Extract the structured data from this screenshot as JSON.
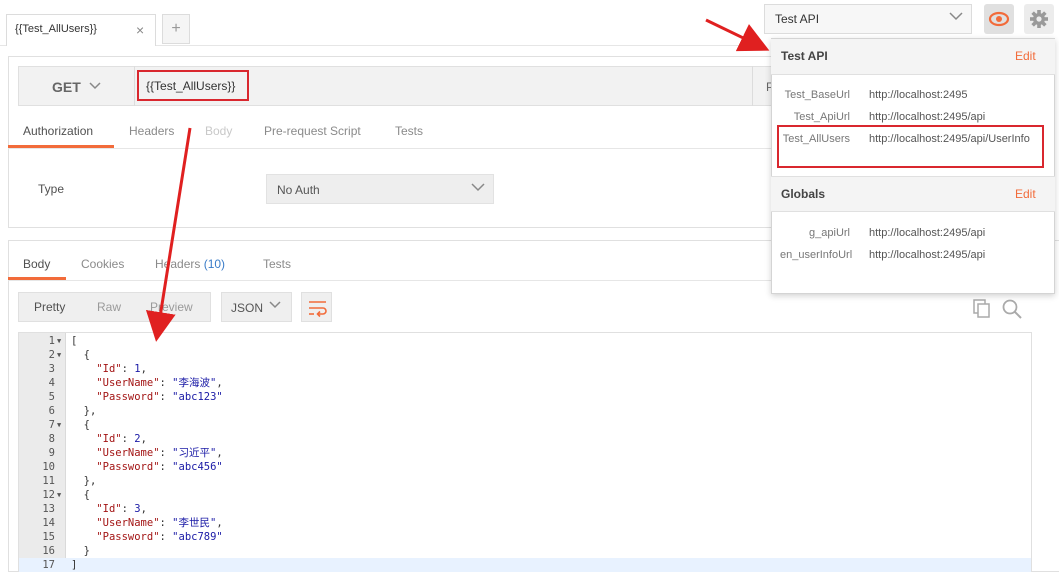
{
  "tabs": {
    "active_tab": "{{Test_AllUsers}}",
    "close": "×",
    "add": "+"
  },
  "environment": {
    "selected": "Test API"
  },
  "request": {
    "method": "GET",
    "url": "{{Test_AllUsers}}",
    "params_stub": "P",
    "tabs": [
      "Authorization",
      "Headers",
      "Body",
      "Pre-request Script",
      "Tests"
    ],
    "auth_type_label": "Type",
    "auth_type_value": "No Auth"
  },
  "response": {
    "tabs": [
      "Body",
      "Cookies",
      "Headers",
      "Tests"
    ],
    "headers_count": "(10)",
    "view_modes": [
      "Pretty",
      "Raw",
      "Preview"
    ],
    "format": "JSON",
    "code": [
      {
        "n": "1",
        "fold": true,
        "parts": [
          [
            "p",
            "["
          ]
        ]
      },
      {
        "n": "2",
        "fold": true,
        "parts": [
          [
            "p",
            "  {"
          ]
        ]
      },
      {
        "n": "3",
        "fold": false,
        "parts": [
          [
            "p",
            "    "
          ],
          [
            "k",
            "\"Id\""
          ],
          [
            "p",
            ": "
          ],
          [
            "n",
            "1"
          ],
          [
            "p",
            ","
          ]
        ]
      },
      {
        "n": "4",
        "fold": false,
        "parts": [
          [
            "p",
            "    "
          ],
          [
            "k",
            "\"UserName\""
          ],
          [
            "p",
            ": "
          ],
          [
            "s",
            "\"李海波\""
          ],
          [
            "p",
            ","
          ]
        ]
      },
      {
        "n": "5",
        "fold": false,
        "parts": [
          [
            "p",
            "    "
          ],
          [
            "k",
            "\"Password\""
          ],
          [
            "p",
            ": "
          ],
          [
            "s",
            "\"abc123\""
          ]
        ]
      },
      {
        "n": "6",
        "fold": false,
        "parts": [
          [
            "p",
            "  },"
          ]
        ]
      },
      {
        "n": "7",
        "fold": true,
        "parts": [
          [
            "p",
            "  {"
          ]
        ]
      },
      {
        "n": "8",
        "fold": false,
        "parts": [
          [
            "p",
            "    "
          ],
          [
            "k",
            "\"Id\""
          ],
          [
            "p",
            ": "
          ],
          [
            "n",
            "2"
          ],
          [
            "p",
            ","
          ]
        ]
      },
      {
        "n": "9",
        "fold": false,
        "parts": [
          [
            "p",
            "    "
          ],
          [
            "k",
            "\"UserName\""
          ],
          [
            "p",
            ": "
          ],
          [
            "s",
            "\"习近平\""
          ],
          [
            "p",
            ","
          ]
        ]
      },
      {
        "n": "10",
        "fold": false,
        "parts": [
          [
            "p",
            "    "
          ],
          [
            "k",
            "\"Password\""
          ],
          [
            "p",
            ": "
          ],
          [
            "s",
            "\"abc456\""
          ]
        ]
      },
      {
        "n": "11",
        "fold": false,
        "parts": [
          [
            "p",
            "  },"
          ]
        ]
      },
      {
        "n": "12",
        "fold": true,
        "parts": [
          [
            "p",
            "  {"
          ]
        ]
      },
      {
        "n": "13",
        "fold": false,
        "parts": [
          [
            "p",
            "    "
          ],
          [
            "k",
            "\"Id\""
          ],
          [
            "p",
            ": "
          ],
          [
            "n",
            "3"
          ],
          [
            "p",
            ","
          ]
        ]
      },
      {
        "n": "14",
        "fold": false,
        "parts": [
          [
            "p",
            "    "
          ],
          [
            "k",
            "\"UserName\""
          ],
          [
            "p",
            ": "
          ],
          [
            "s",
            "\"李世民\""
          ],
          [
            "p",
            ","
          ]
        ]
      },
      {
        "n": "15",
        "fold": false,
        "parts": [
          [
            "p",
            "    "
          ],
          [
            "k",
            "\"Password\""
          ],
          [
            "p",
            ": "
          ],
          [
            "s",
            "\"abc789\""
          ]
        ]
      },
      {
        "n": "16",
        "fold": false,
        "parts": [
          [
            "p",
            "  }"
          ]
        ]
      },
      {
        "n": "17",
        "fold": false,
        "parts": [
          [
            "p",
            "]"
          ]
        ]
      }
    ]
  },
  "env_popup": {
    "env_title": "Test API",
    "env_edit": "Edit",
    "env_vars": [
      {
        "key": "Test_BaseUrl",
        "value": "http://localhost:2495"
      },
      {
        "key": "Test_ApiUrl",
        "value": "http://localhost:2495/api"
      },
      {
        "key": "Test_AllUsers",
        "value": "http://localhost:2495/api/UserInfo"
      }
    ],
    "globals_title": "Globals",
    "globals_edit": "Edit",
    "globals_vars": [
      {
        "key": "g_apiUrl",
        "value": "http://localhost:2495/api"
      },
      {
        "key": "en_userInfoUrl",
        "value": "http://localhost:2495/api"
      }
    ]
  },
  "colors": {
    "accent": "#f26b3a",
    "annotation": "#d9272e",
    "link_count": "#3a7cc8"
  }
}
